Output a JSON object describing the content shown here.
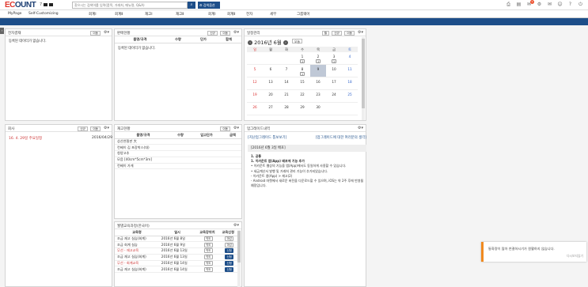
{
  "topbar": {
    "logo_prefix": "EC",
    "logo_suffix": "OUNT",
    "company_code": "7",
    "search_placeholder": "찾으시는 검색어를 입력(품목, 거래처, 메뉴명, Q&A)",
    "search_option_label": "검색옵션",
    "notification_count": "1"
  },
  "menu": [
    "MyPage",
    "Self-Customizing",
    "회계Ⅰ",
    "회계Ⅱ",
    "재고Ⅰ",
    "재고Ⅱ",
    "회계Ⅰ",
    "회계Ⅱ",
    "전자",
    "세무",
    "그룹웨어"
  ],
  "panels": {
    "left_top": {
      "title": "전자결재",
      "btn1": "이동",
      "empty": "등록된 데이터가 없습니다."
    },
    "sales": {
      "title": "판매현황",
      "btn_add": "신규",
      "btn_move": "이동",
      "columns": [
        "품명/규격",
        "수량",
        "단가",
        "합계"
      ],
      "empty": "등록된 데이터가 없습니다."
    },
    "calendar": {
      "title": "일정관리",
      "btn_all": "월",
      "btn_add": "신규",
      "btn_move": "이동",
      "month_label": "2016년 6월",
      "today_label": "오늘",
      "weekdays": [
        "일",
        "월",
        "화",
        "수",
        "목",
        "금",
        "토"
      ],
      "weeks": [
        [
          "",
          "",
          "",
          "1",
          "2",
          "3",
          "4"
        ],
        [
          "5",
          "6",
          "7",
          "8",
          "9",
          "10",
          "11"
        ],
        [
          "12",
          "13",
          "14",
          "15",
          "16",
          "17",
          "18"
        ],
        [
          "19",
          "20",
          "21",
          "22",
          "23",
          "24",
          "25"
        ],
        [
          "26",
          "27",
          "28",
          "29",
          "30",
          "",
          ""
        ]
      ],
      "events": {
        "0-3": "1",
        "0-4": "1",
        "0-5": "1",
        "1-3": "1"
      },
      "selected": "1-4"
    },
    "notice": {
      "title": "회사",
      "btn_add": "신규",
      "btn_move": "이동",
      "item_title": "16. 4. 29일 주요일정",
      "item_date": "2016/04/29"
    },
    "inventory": {
      "title": "재고현황",
      "btn_move": "이동",
      "columns": [
        "품명/규격",
        "수량",
        "입고단가",
        "금액"
      ],
      "rows": [
        [
          "상산연필판 大",
          "",
          "",
          ""
        ],
        [
          "컨베이 김 포장박스(대)",
          "",
          "",
          ""
        ],
        [
          "청양고추",
          "",
          "",
          ""
        ],
        [
          "모음 [40cm*5cm*3m]",
          "",
          "",
          ""
        ],
        [
          "컨베이 가게",
          "",
          "",
          ""
        ]
      ]
    },
    "updates": {
      "title": "업그레이드내역",
      "link1": "[지난업그레이드 통보보기]",
      "link2": "[업그레이드에 대한 여러분의 생각]",
      "box_title": "[2016년 6월 3일 배포]",
      "section": "1. 공통",
      "subsection": "1. 이카운트 앱(App) 배포에 기능 추가",
      "lines": [
        "• 이카운트 웹상의 기능을 앱(App)에서도 동일하게 사용할 수 있습니다.",
        "• 세금계산서 발행 및 거래처 관리 기능이 추가되었습니다.",
        "- 이카운트 앱(App) > 재고(2)",
        "- Android 마켓에서 새로운 버전을 다운로드할 수 있으며, iOS는 약 2주 후에 반영될 예정입니다."
      ]
    },
    "education": {
      "title": "월별교육과정(한국어)",
      "columns": [
        "교육명",
        "일시",
        "교육장위치",
        "교육신청"
      ],
      "rows": [
        {
          "name": "조금 재고 실습(회계)",
          "date": "2016년 6월 8일",
          "place": "약도",
          "status": "마감",
          "red": false
        },
        {
          "name": "조금 회계 실습",
          "date": "2016년 6월 9일",
          "place": "약도",
          "status": "마감",
          "red": false
        },
        {
          "name": "무선 - 재고교육",
          "date": "2016년 6월 13일",
          "place": "약도",
          "status": "신청",
          "red": true
        },
        {
          "name": "조금 재고 실습(회계)",
          "date": "2016년 6월 13일",
          "place": "약도",
          "status": "신청",
          "red": false
        },
        {
          "name": "무선 - 회계교육",
          "date": "2016년 6월 14일",
          "place": "약도",
          "status": "신청",
          "red": true
        },
        {
          "name": "조금 재고 실습(회계)",
          "date": "2016년 6월 14일",
          "place": "약도",
          "status": "신청",
          "red": false
        }
      ]
    }
  },
  "toast": {
    "message": "통화량이 많아 연결하시기가 원활하지 않습니다.",
    "link": "다시보지않기"
  }
}
